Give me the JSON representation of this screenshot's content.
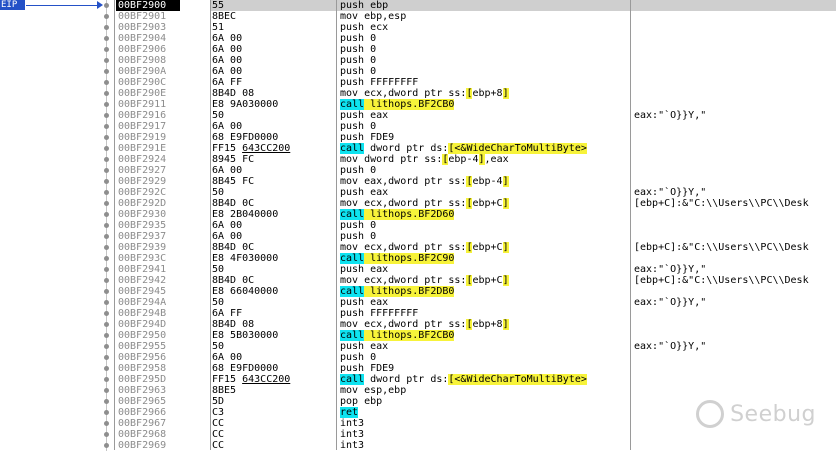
{
  "eip_label": "EIP",
  "watermark_text": "Seebug",
  "colors": {
    "eip": "#2451c7",
    "call_highlight": "#0ee3f0",
    "bracket_highlight": "#f7f33a",
    "address": "#8c8c8c"
  },
  "rows": [
    {
      "addr": "00BF2900",
      "bytes": "55",
      "dis": [
        {
          "t": "push ebp"
        }
      ],
      "cmt": ""
    },
    {
      "addr": "00BF2901",
      "bytes": "8BEC",
      "dis": [
        {
          "t": "mov ebp,esp"
        }
      ],
      "cmt": ""
    },
    {
      "addr": "00BF2903",
      "bytes": "51",
      "dis": [
        {
          "t": "push ecx"
        }
      ],
      "cmt": ""
    },
    {
      "addr": "00BF2904",
      "bytes": "6A 00",
      "dis": [
        {
          "t": "push 0"
        }
      ],
      "cmt": ""
    },
    {
      "addr": "00BF2906",
      "bytes": "6A 00",
      "dis": [
        {
          "t": "push 0"
        }
      ],
      "cmt": ""
    },
    {
      "addr": "00BF2908",
      "bytes": "6A 00",
      "dis": [
        {
          "t": "push 0"
        }
      ],
      "cmt": ""
    },
    {
      "addr": "00BF290A",
      "bytes": "6A 00",
      "dis": [
        {
          "t": "push 0"
        }
      ],
      "cmt": ""
    },
    {
      "addr": "00BF290C",
      "bytes": "6A FF",
      "dis": [
        {
          "t": "push FFFFFFFF"
        }
      ],
      "cmt": ""
    },
    {
      "addr": "00BF290E",
      "bytes": "8B4D 08",
      "dis": [
        {
          "t": "mov ecx,dword ptr ss:"
        },
        {
          "t": "[",
          "c": "br"
        },
        {
          "t": "ebp+8"
        },
        {
          "t": "]",
          "c": "br"
        }
      ],
      "cmt": ""
    },
    {
      "addr": "00BF2911",
      "bytes": "E8 9A030000",
      "dis": [
        {
          "t": "call",
          "c": "call"
        },
        {
          "t": " lithops.BF2CB0",
          "c": "br"
        }
      ],
      "cmt": ""
    },
    {
      "addr": "00BF2916",
      "bytes": "50",
      "dis": [
        {
          "t": "push eax"
        }
      ],
      "cmt": "eax:\"`O}}Y,\""
    },
    {
      "addr": "00BF2917",
      "bytes": "6A 00",
      "dis": [
        {
          "t": "push 0"
        }
      ],
      "cmt": ""
    },
    {
      "addr": "00BF2919",
      "bytes": "68 E9FD0000",
      "dis": [
        {
          "t": "push FDE9"
        }
      ],
      "cmt": ""
    },
    {
      "addr": "00BF291E",
      "bytes": "FF15 643CC200",
      "bu": "643CC200",
      "dis": [
        {
          "t": "call",
          "c": "call"
        },
        {
          "t": " dword ptr ds:"
        },
        {
          "t": "[<&WideCharToMultiByte>",
          "c": "br"
        }
      ],
      "cmt": ""
    },
    {
      "addr": "00BF2924",
      "bytes": "8945 FC",
      "dis": [
        {
          "t": "mov dword ptr ss:"
        },
        {
          "t": "[",
          "c": "br"
        },
        {
          "t": "ebp-4"
        },
        {
          "t": "]",
          "c": "br"
        },
        {
          "t": ",eax"
        }
      ],
      "cmt": ""
    },
    {
      "addr": "00BF2927",
      "bytes": "6A 00",
      "dis": [
        {
          "t": "push 0"
        }
      ],
      "cmt": ""
    },
    {
      "addr": "00BF2929",
      "bytes": "8B45 FC",
      "dis": [
        {
          "t": "mov eax,dword ptr ss:"
        },
        {
          "t": "[",
          "c": "br"
        },
        {
          "t": "ebp-4"
        },
        {
          "t": "]",
          "c": "br"
        }
      ],
      "cmt": ""
    },
    {
      "addr": "00BF292C",
      "bytes": "50",
      "dis": [
        {
          "t": "push eax"
        }
      ],
      "cmt": "eax:\"`O}}Y,\""
    },
    {
      "addr": "00BF292D",
      "bytes": "8B4D 0C",
      "dis": [
        {
          "t": "mov ecx,dword ptr ss:"
        },
        {
          "t": "[",
          "c": "br"
        },
        {
          "t": "ebp+C"
        },
        {
          "t": "]",
          "c": "br"
        }
      ],
      "cmt": "[ebp+C]:&\"C:\\\\Users\\\\PC\\\\Desk"
    },
    {
      "addr": "00BF2930",
      "bytes": "E8 2B040000",
      "dis": [
        {
          "t": "call",
          "c": "call"
        },
        {
          "t": " lithops.BF2D60",
          "c": "br"
        }
      ],
      "cmt": ""
    },
    {
      "addr": "00BF2935",
      "bytes": "6A 00",
      "dis": [
        {
          "t": "push 0"
        }
      ],
      "cmt": ""
    },
    {
      "addr": "00BF2937",
      "bytes": "6A 00",
      "dis": [
        {
          "t": "push 0"
        }
      ],
      "cmt": ""
    },
    {
      "addr": "00BF2939",
      "bytes": "8B4D 0C",
      "dis": [
        {
          "t": "mov ecx,dword ptr ss:"
        },
        {
          "t": "[",
          "c": "br"
        },
        {
          "t": "ebp+C"
        },
        {
          "t": "]",
          "c": "br"
        }
      ],
      "cmt": "[ebp+C]:&\"C:\\\\Users\\\\PC\\\\Desk"
    },
    {
      "addr": "00BF293C",
      "bytes": "E8 4F030000",
      "dis": [
        {
          "t": "call",
          "c": "call"
        },
        {
          "t": " lithops.BF2C90",
          "c": "br"
        }
      ],
      "cmt": ""
    },
    {
      "addr": "00BF2941",
      "bytes": "50",
      "dis": [
        {
          "t": "push eax"
        }
      ],
      "cmt": "eax:\"`O}}Y,\""
    },
    {
      "addr": "00BF2942",
      "bytes": "8B4D 0C",
      "dis": [
        {
          "t": "mov ecx,dword ptr ss:"
        },
        {
          "t": "[",
          "c": "br"
        },
        {
          "t": "ebp+C"
        },
        {
          "t": "]",
          "c": "br"
        }
      ],
      "cmt": "[ebp+C]:&\"C:\\\\Users\\\\PC\\\\Desk"
    },
    {
      "addr": "00BF2945",
      "bytes": "E8 66040000",
      "dis": [
        {
          "t": "call",
          "c": "call"
        },
        {
          "t": " lithops.BF2DB0",
          "c": "br"
        }
      ],
      "cmt": ""
    },
    {
      "addr": "00BF294A",
      "bytes": "50",
      "dis": [
        {
          "t": "push eax"
        }
      ],
      "cmt": "eax:\"`O}}Y,\""
    },
    {
      "addr": "00BF294B",
      "bytes": "6A FF",
      "dis": [
        {
          "t": "push FFFFFFFF"
        }
      ],
      "cmt": ""
    },
    {
      "addr": "00BF294D",
      "bytes": "8B4D 08",
      "dis": [
        {
          "t": "mov ecx,dword ptr ss:"
        },
        {
          "t": "[",
          "c": "br"
        },
        {
          "t": "ebp+8"
        },
        {
          "t": "]",
          "c": "br"
        }
      ],
      "cmt": ""
    },
    {
      "addr": "00BF2950",
      "bytes": "E8 5B030000",
      "dis": [
        {
          "t": "call",
          "c": "call"
        },
        {
          "t": " lithops.BF2CB0",
          "c": "br"
        }
      ],
      "cmt": ""
    },
    {
      "addr": "00BF2955",
      "bytes": "50",
      "dis": [
        {
          "t": "push eax"
        }
      ],
      "cmt": "eax:\"`O}}Y,\""
    },
    {
      "addr": "00BF2956",
      "bytes": "6A 00",
      "dis": [
        {
          "t": "push 0"
        }
      ],
      "cmt": ""
    },
    {
      "addr": "00BF2958",
      "bytes": "68 E9FD0000",
      "dis": [
        {
          "t": "push FDE9"
        }
      ],
      "cmt": ""
    },
    {
      "addr": "00BF295D",
      "bytes": "FF15 643CC200",
      "bu": "643CC200",
      "dis": [
        {
          "t": "call",
          "c": "call"
        },
        {
          "t": " dword ptr ds:"
        },
        {
          "t": "[<&WideCharToMultiByte>",
          "c": "br"
        }
      ],
      "cmt": ""
    },
    {
      "addr": "00BF2963",
      "bytes": "8BE5",
      "dis": [
        {
          "t": "mov esp,ebp"
        }
      ],
      "cmt": ""
    },
    {
      "addr": "00BF2965",
      "bytes": "5D",
      "dis": [
        {
          "t": "pop ebp"
        }
      ],
      "cmt": ""
    },
    {
      "addr": "00BF2966",
      "bytes": "C3",
      "dis": [
        {
          "t": "ret",
          "c": "call"
        }
      ],
      "cmt": ""
    },
    {
      "addr": "00BF2967",
      "bytes": "CC",
      "dis": [
        {
          "t": "int3"
        }
      ],
      "cmt": ""
    },
    {
      "addr": "00BF2968",
      "bytes": "CC",
      "dis": [
        {
          "t": "int3"
        }
      ],
      "cmt": ""
    },
    {
      "addr": "00BF2969",
      "bytes": "CC",
      "dis": [
        {
          "t": "int3"
        }
      ],
      "cmt": ""
    }
  ]
}
